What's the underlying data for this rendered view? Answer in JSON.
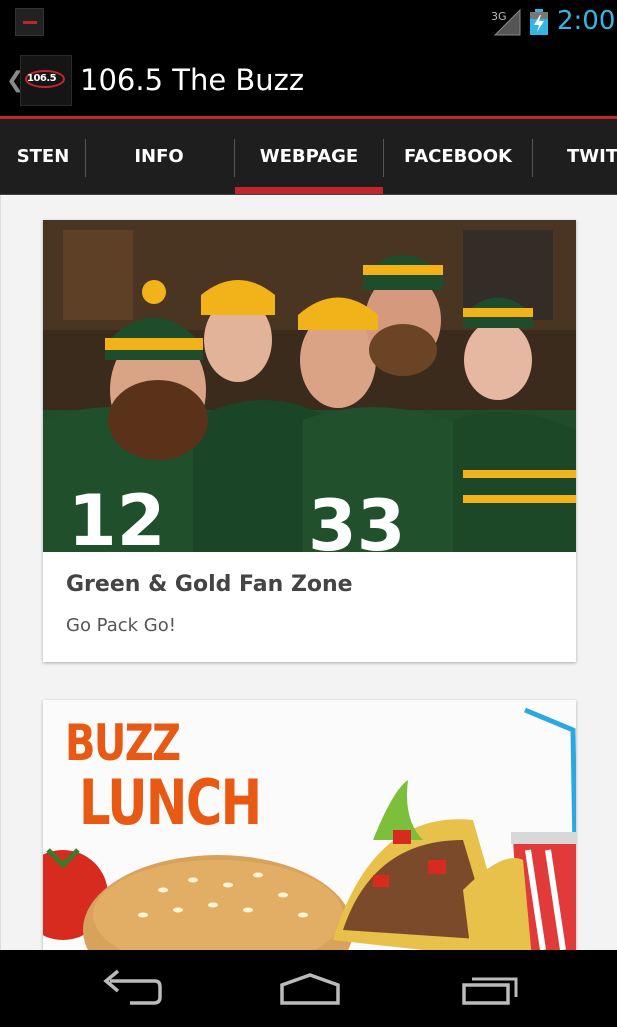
{
  "status_bar": {
    "network": "3G",
    "time": "2:00",
    "clock_color": "#33b5e5"
  },
  "action_bar": {
    "logo_text": "106.5",
    "title": "106.5 The Buzz",
    "up_icon": "chevron-left-icon",
    "accent": "#c0262c"
  },
  "tabs": {
    "items": [
      {
        "label": "STEN"
      },
      {
        "label": "INFO"
      },
      {
        "label": "WEBPAGE"
      },
      {
        "label": "FACEBOOK"
      },
      {
        "label": "TWITT"
      }
    ],
    "selected": "WEBPAGE"
  },
  "cards": [
    {
      "title": "Green & Gold Fan Zone",
      "subtitle": "Go Pack Go!",
      "image": "fans-photo"
    },
    {
      "image_line1": "BUZZ",
      "image_line2": "LUNCH"
    }
  ],
  "nav_bar": {
    "buttons": [
      "back-icon",
      "home-icon",
      "recents-icon"
    ]
  }
}
